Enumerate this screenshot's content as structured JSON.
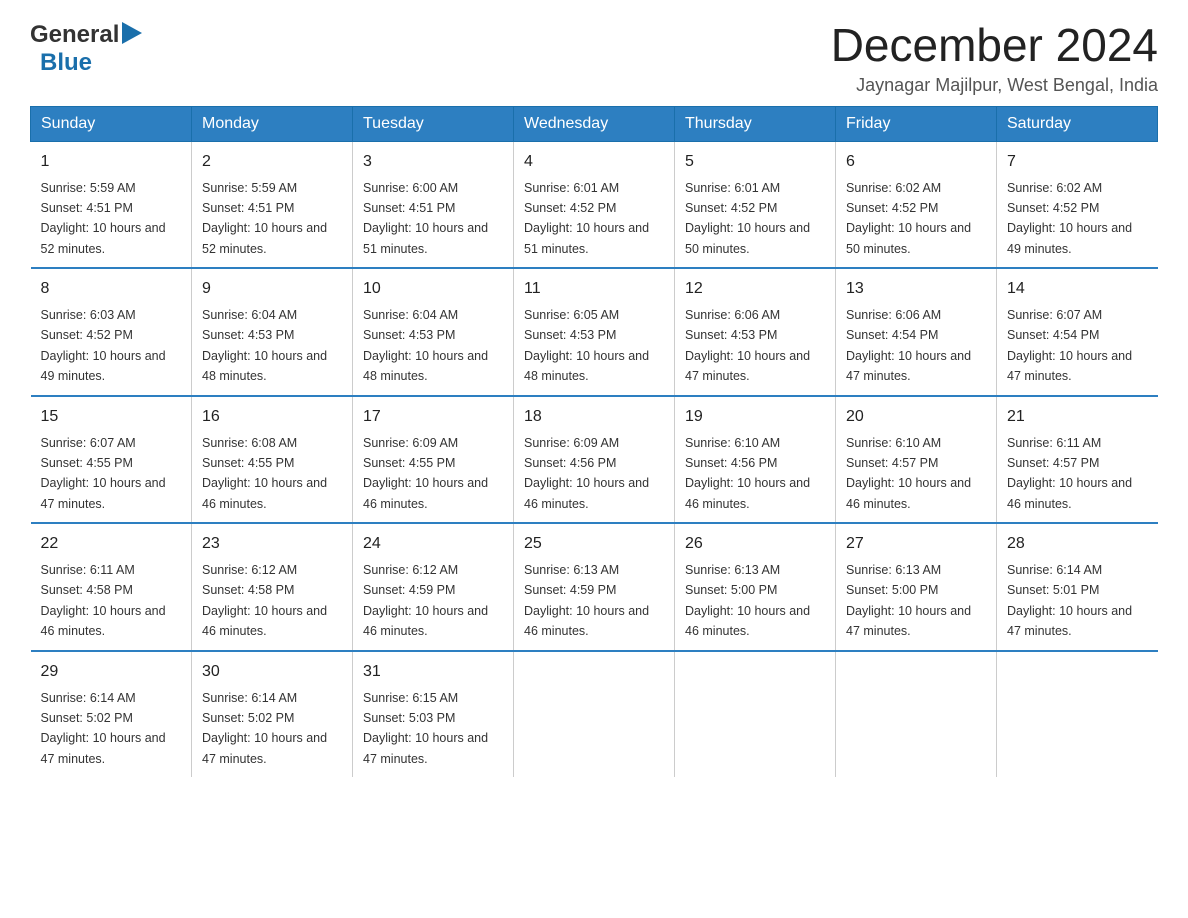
{
  "header": {
    "logo": {
      "text_general": "General",
      "text_blue": "Blue",
      "aria": "GeneralBlue logo"
    },
    "title": "December 2024",
    "subtitle": "Jaynagar Majilpur, West Bengal, India"
  },
  "calendar": {
    "weekdays": [
      "Sunday",
      "Monday",
      "Tuesday",
      "Wednesday",
      "Thursday",
      "Friday",
      "Saturday"
    ],
    "weeks": [
      [
        {
          "day": "1",
          "sunrise": "5:59 AM",
          "sunset": "4:51 PM",
          "daylight": "10 hours and 52 minutes."
        },
        {
          "day": "2",
          "sunrise": "5:59 AM",
          "sunset": "4:51 PM",
          "daylight": "10 hours and 52 minutes."
        },
        {
          "day": "3",
          "sunrise": "6:00 AM",
          "sunset": "4:51 PM",
          "daylight": "10 hours and 51 minutes."
        },
        {
          "day": "4",
          "sunrise": "6:01 AM",
          "sunset": "4:52 PM",
          "daylight": "10 hours and 51 minutes."
        },
        {
          "day": "5",
          "sunrise": "6:01 AM",
          "sunset": "4:52 PM",
          "daylight": "10 hours and 50 minutes."
        },
        {
          "day": "6",
          "sunrise": "6:02 AM",
          "sunset": "4:52 PM",
          "daylight": "10 hours and 50 minutes."
        },
        {
          "day": "7",
          "sunrise": "6:02 AM",
          "sunset": "4:52 PM",
          "daylight": "10 hours and 49 minutes."
        }
      ],
      [
        {
          "day": "8",
          "sunrise": "6:03 AM",
          "sunset": "4:52 PM",
          "daylight": "10 hours and 49 minutes."
        },
        {
          "day": "9",
          "sunrise": "6:04 AM",
          "sunset": "4:53 PM",
          "daylight": "10 hours and 48 minutes."
        },
        {
          "day": "10",
          "sunrise": "6:04 AM",
          "sunset": "4:53 PM",
          "daylight": "10 hours and 48 minutes."
        },
        {
          "day": "11",
          "sunrise": "6:05 AM",
          "sunset": "4:53 PM",
          "daylight": "10 hours and 48 minutes."
        },
        {
          "day": "12",
          "sunrise": "6:06 AM",
          "sunset": "4:53 PM",
          "daylight": "10 hours and 47 minutes."
        },
        {
          "day": "13",
          "sunrise": "6:06 AM",
          "sunset": "4:54 PM",
          "daylight": "10 hours and 47 minutes."
        },
        {
          "day": "14",
          "sunrise": "6:07 AM",
          "sunset": "4:54 PM",
          "daylight": "10 hours and 47 minutes."
        }
      ],
      [
        {
          "day": "15",
          "sunrise": "6:07 AM",
          "sunset": "4:55 PM",
          "daylight": "10 hours and 47 minutes."
        },
        {
          "day": "16",
          "sunrise": "6:08 AM",
          "sunset": "4:55 PM",
          "daylight": "10 hours and 46 minutes."
        },
        {
          "day": "17",
          "sunrise": "6:09 AM",
          "sunset": "4:55 PM",
          "daylight": "10 hours and 46 minutes."
        },
        {
          "day": "18",
          "sunrise": "6:09 AM",
          "sunset": "4:56 PM",
          "daylight": "10 hours and 46 minutes."
        },
        {
          "day": "19",
          "sunrise": "6:10 AM",
          "sunset": "4:56 PM",
          "daylight": "10 hours and 46 minutes."
        },
        {
          "day": "20",
          "sunrise": "6:10 AM",
          "sunset": "4:57 PM",
          "daylight": "10 hours and 46 minutes."
        },
        {
          "day": "21",
          "sunrise": "6:11 AM",
          "sunset": "4:57 PM",
          "daylight": "10 hours and 46 minutes."
        }
      ],
      [
        {
          "day": "22",
          "sunrise": "6:11 AM",
          "sunset": "4:58 PM",
          "daylight": "10 hours and 46 minutes."
        },
        {
          "day": "23",
          "sunrise": "6:12 AM",
          "sunset": "4:58 PM",
          "daylight": "10 hours and 46 minutes."
        },
        {
          "day": "24",
          "sunrise": "6:12 AM",
          "sunset": "4:59 PM",
          "daylight": "10 hours and 46 minutes."
        },
        {
          "day": "25",
          "sunrise": "6:13 AM",
          "sunset": "4:59 PM",
          "daylight": "10 hours and 46 minutes."
        },
        {
          "day": "26",
          "sunrise": "6:13 AM",
          "sunset": "5:00 PM",
          "daylight": "10 hours and 46 minutes."
        },
        {
          "day": "27",
          "sunrise": "6:13 AM",
          "sunset": "5:00 PM",
          "daylight": "10 hours and 47 minutes."
        },
        {
          "day": "28",
          "sunrise": "6:14 AM",
          "sunset": "5:01 PM",
          "daylight": "10 hours and 47 minutes."
        }
      ],
      [
        {
          "day": "29",
          "sunrise": "6:14 AM",
          "sunset": "5:02 PM",
          "daylight": "10 hours and 47 minutes."
        },
        {
          "day": "30",
          "sunrise": "6:14 AM",
          "sunset": "5:02 PM",
          "daylight": "10 hours and 47 minutes."
        },
        {
          "day": "31",
          "sunrise": "6:15 AM",
          "sunset": "5:03 PM",
          "daylight": "10 hours and 47 minutes."
        },
        null,
        null,
        null,
        null
      ]
    ]
  }
}
